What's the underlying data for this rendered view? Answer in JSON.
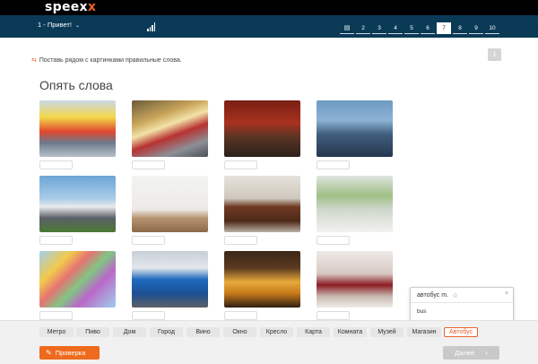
{
  "app": {
    "logo_text": "speex",
    "logo_accent": "x",
    "brand_color": "#e8622a"
  },
  "nav": {
    "lesson_label": "1 - Привет!",
    "lesson_chevron": "⌄",
    "pages": [
      {
        "label": "▤",
        "active": false
      },
      {
        "label": "2",
        "active": false
      },
      {
        "label": "3",
        "active": false
      },
      {
        "label": "4",
        "active": false
      },
      {
        "label": "5",
        "active": false
      },
      {
        "label": "6",
        "active": false
      },
      {
        "label": "7",
        "active": true
      },
      {
        "label": "8",
        "active": false
      },
      {
        "label": "9",
        "active": false
      },
      {
        "label": "10",
        "active": false
      }
    ]
  },
  "exercise": {
    "instruction_icon": "⇆",
    "instruction": "Поставь рядом с картинками правильные слова.",
    "info_icon": "i",
    "title": "Опять слова"
  },
  "images": [
    {
      "name": "supermarket-image"
    },
    {
      "name": "metro-image"
    },
    {
      "name": "museum-image"
    },
    {
      "name": "city-image"
    },
    {
      "name": "house-image"
    },
    {
      "name": "room-image"
    },
    {
      "name": "armchair-image"
    },
    {
      "name": "window-image"
    },
    {
      "name": "map-image"
    },
    {
      "name": "bus-image"
    },
    {
      "name": "beer-image"
    },
    {
      "name": "wine-image"
    }
  ],
  "popup": {
    "word": "автобус m.",
    "star_icon": "☆",
    "close_icon": "×",
    "translation": "bus"
  },
  "word_bank": [
    {
      "label": "Метро",
      "selected": false
    },
    {
      "label": "Пиво",
      "selected": false
    },
    {
      "label": "Дом",
      "selected": false
    },
    {
      "label": "Город",
      "selected": false
    },
    {
      "label": "Вино",
      "selected": false
    },
    {
      "label": "Окно",
      "selected": false
    },
    {
      "label": "Кресло",
      "selected": false
    },
    {
      "label": "Карта",
      "selected": false
    },
    {
      "label": "Комната",
      "selected": false
    },
    {
      "label": "Музей",
      "selected": false
    },
    {
      "label": "Магазин",
      "selected": false
    },
    {
      "label": "Автобус",
      "selected": true
    }
  ],
  "buttons": {
    "check_icon": "✎",
    "check_label": "Проверка",
    "next_label": "Далее",
    "next_icon": "›"
  }
}
